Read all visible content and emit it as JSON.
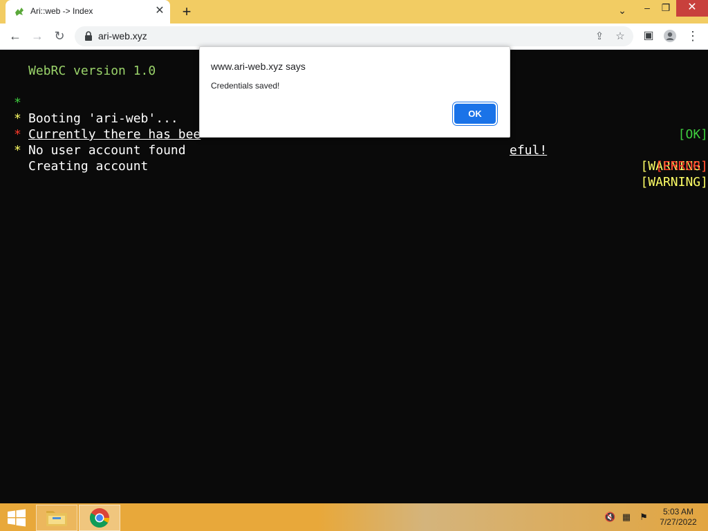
{
  "browser": {
    "tab_title": "Ari::web -> Index",
    "url": "ari-web.xyz"
  },
  "terminal": {
    "version_line": "WebRC version 1.0",
    "lines": [
      {
        "bullet": "*",
        "text": "Booting 'ari-web'...",
        "status": "[OK]",
        "bullet_color": "#3fcf3f"
      },
      {
        "bullet": "*",
        "text_left": "Currently there has bee",
        "text_right": "eful!",
        "status": "[WARNING]",
        "bullet_color": "#ffff66"
      },
      {
        "bullet": "*",
        "text": "No user account found",
        "status": "[ERROR]",
        "bullet_color": "#ff3a2a"
      },
      {
        "bullet": "*",
        "text": "Creating account",
        "status": "[WARNING]",
        "bullet_color": "#ffff66"
      }
    ]
  },
  "dialog": {
    "title": "www.ari-web.xyz says",
    "message": "Credentials saved!",
    "ok_label": "OK"
  },
  "taskbar": {
    "time": "5:03 AM",
    "date": "7/27/2022"
  },
  "colors": {
    "accent": "#1a73e8",
    "tabstrip": "#f2cc63",
    "ok": "#3fcf3f",
    "warning": "#ffff66",
    "error": "#ff3a2a"
  }
}
